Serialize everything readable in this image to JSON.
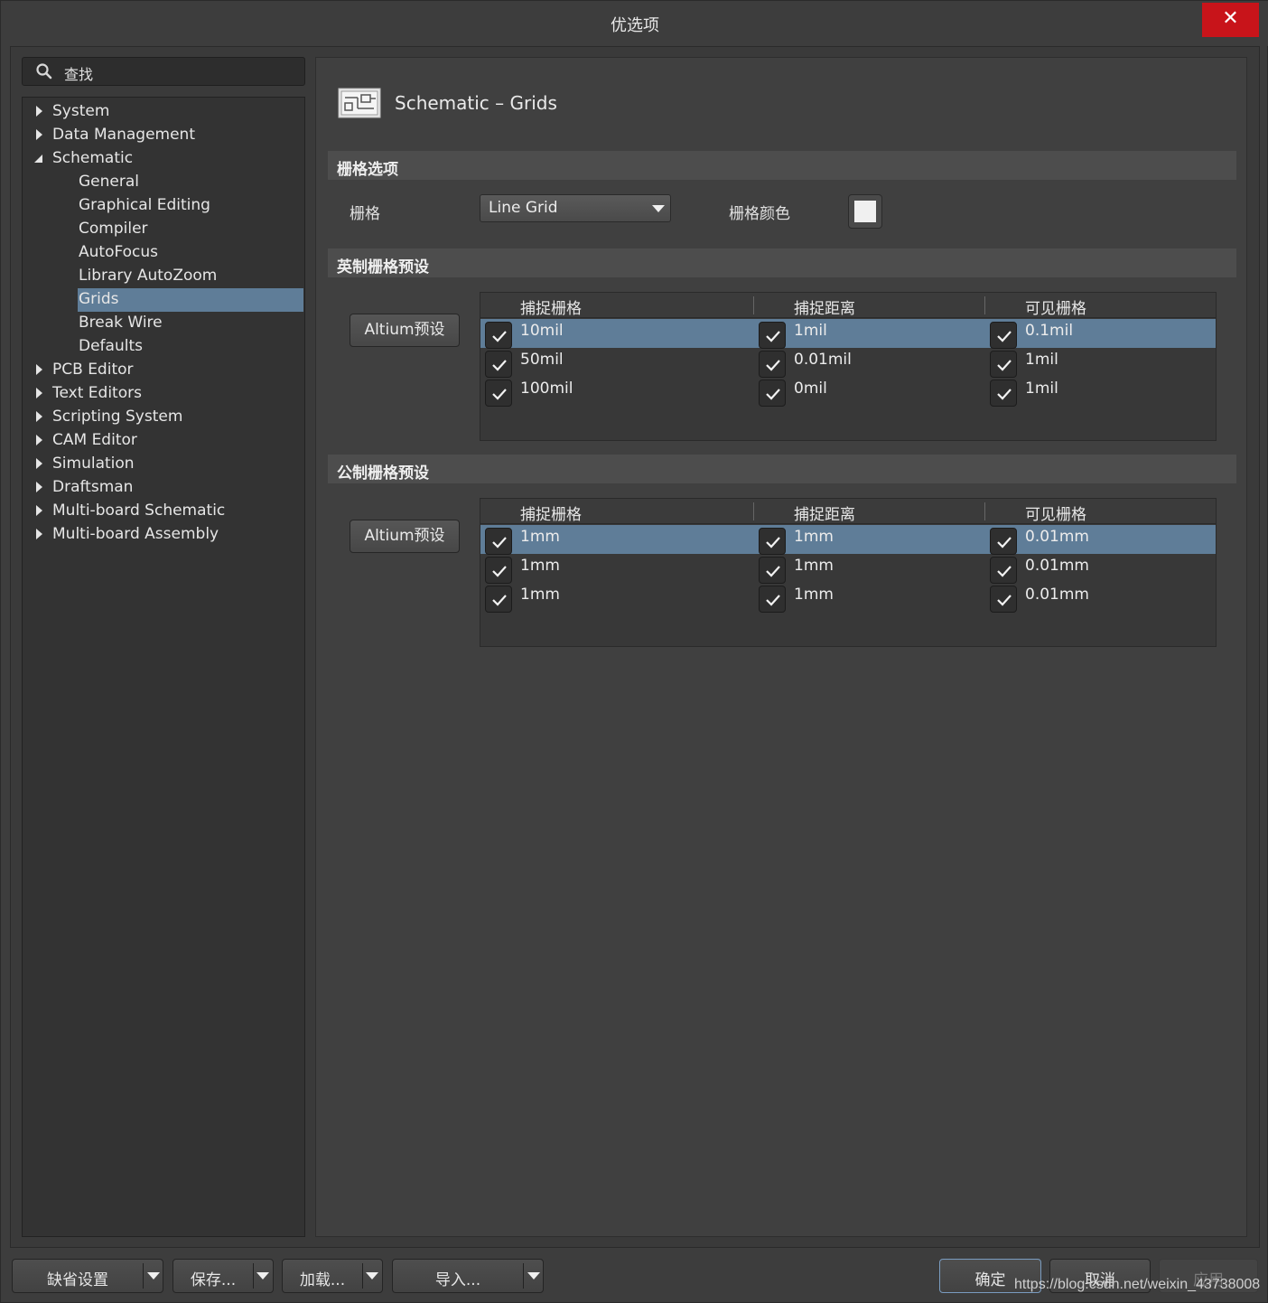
{
  "window": {
    "title": "优选项",
    "close_glyph": "✕"
  },
  "search": {
    "placeholder": "查找",
    "icon": "search-icon"
  },
  "tree": {
    "top_items": [
      {
        "label": "System",
        "expanded": false
      },
      {
        "label": "Data Management",
        "expanded": false
      },
      {
        "label": "Schematic",
        "expanded": true
      },
      {
        "label": "PCB Editor",
        "expanded": false
      },
      {
        "label": "Text Editors",
        "expanded": false
      },
      {
        "label": "Scripting System",
        "expanded": false
      },
      {
        "label": "CAM Editor",
        "expanded": false
      },
      {
        "label": "Simulation",
        "expanded": false
      },
      {
        "label": "Draftsman",
        "expanded": false
      },
      {
        "label": "Multi-board Schematic",
        "expanded": false
      },
      {
        "label": "Multi-board Assembly",
        "expanded": false
      }
    ],
    "schematic_children": [
      {
        "label": "General"
      },
      {
        "label": "Graphical Editing"
      },
      {
        "label": "Compiler"
      },
      {
        "label": "AutoFocus"
      },
      {
        "label": "Library AutoZoom"
      },
      {
        "label": "Grids",
        "selected": true
      },
      {
        "label": "Break Wire"
      },
      {
        "label": "Defaults"
      }
    ]
  },
  "panel": {
    "title": "Schematic – Grids",
    "grid_options": {
      "section_label": "栅格选项",
      "grid_label": "栅格",
      "grid_value": "Line Grid",
      "color_label": "栅格颜色",
      "color_value": "#f0f0f0"
    },
    "imperial": {
      "section_label": "英制栅格预设",
      "preset_button": "Altium预设",
      "columns": [
        "捕捉栅格",
        "捕捉距离",
        "可见栅格"
      ],
      "rows": [
        {
          "selected": true,
          "values": [
            "10mil",
            "1mil",
            "0.1mil"
          ],
          "checked": [
            true,
            true,
            true
          ]
        },
        {
          "selected": false,
          "values": [
            "50mil",
            "0.01mil",
            "1mil"
          ],
          "checked": [
            true,
            true,
            true
          ]
        },
        {
          "selected": false,
          "values": [
            "100mil",
            "0mil",
            "1mil"
          ],
          "checked": [
            true,
            true,
            true
          ]
        }
      ]
    },
    "metric": {
      "section_label": "公制栅格预设",
      "preset_button": "Altium预设",
      "columns": [
        "捕捉栅格",
        "捕捉距离",
        "可见栅格"
      ],
      "rows": [
        {
          "selected": true,
          "values": [
            "1mm",
            "1mm",
            "0.01mm"
          ],
          "checked": [
            true,
            true,
            true
          ]
        },
        {
          "selected": false,
          "values": [
            "1mm",
            "1mm",
            "0.01mm"
          ],
          "checked": [
            true,
            true,
            true
          ]
        },
        {
          "selected": false,
          "values": [
            "1mm",
            "1mm",
            "0.01mm"
          ],
          "checked": [
            true,
            true,
            true
          ]
        }
      ]
    }
  },
  "footer": {
    "defaults_button": "缺省设置",
    "save_button": "保存...",
    "load_button": "加载...",
    "import_button": "导入...",
    "ok_button": "确定",
    "cancel_button": "取消",
    "apply_button": "应用"
  },
  "watermark": "https://blog.csdn.net/weixin_43738008",
  "colors": {
    "selection": "#5f7d98",
    "close": "#c8141a",
    "background": "#3d3d3d"
  }
}
